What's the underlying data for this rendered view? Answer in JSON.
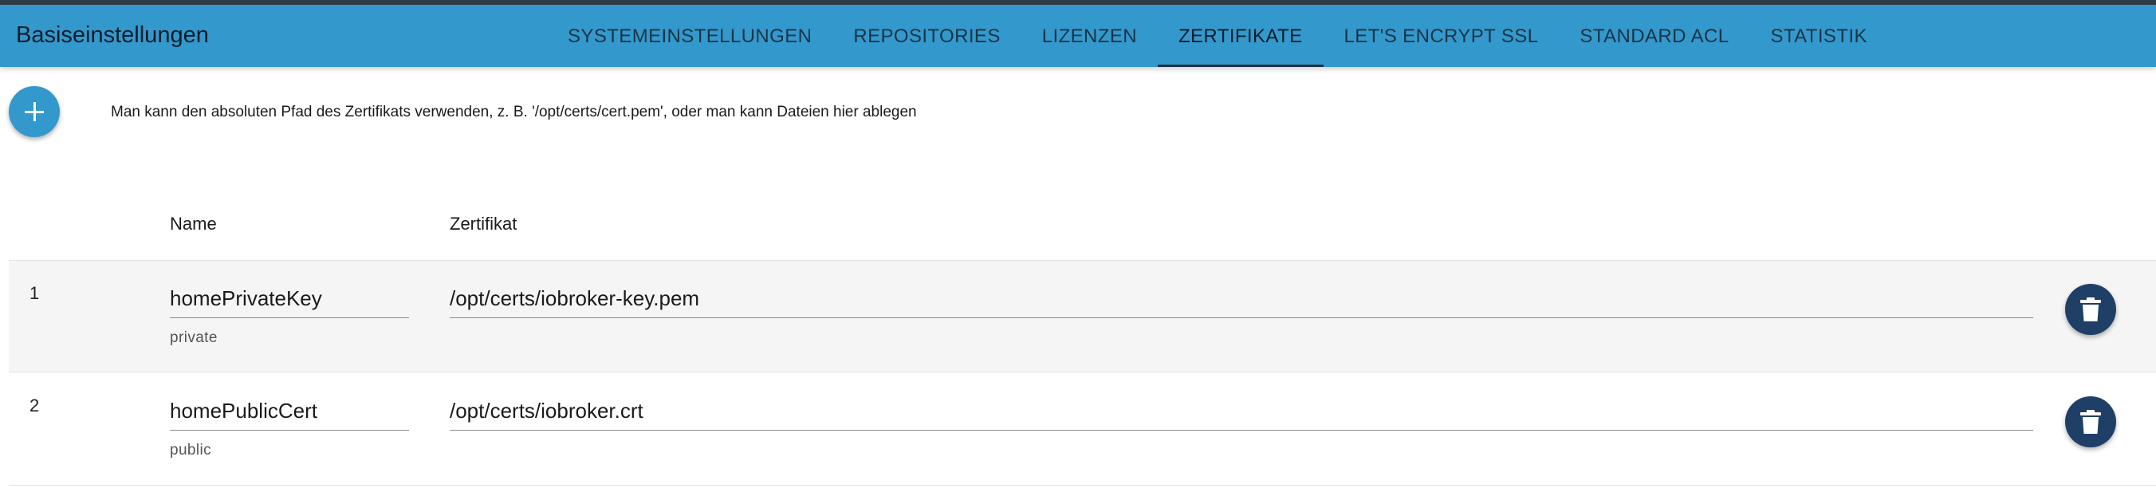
{
  "header": {
    "title": "Basiseinstellungen",
    "tabs": [
      {
        "label": "SYSTEMEINSTELLUNGEN"
      },
      {
        "label": "REPOSITORIES"
      },
      {
        "label": "LIZENZEN"
      },
      {
        "label": "ZERTIFIKATE",
        "active": true
      },
      {
        "label": "LET'S ENCRYPT SSL"
      },
      {
        "label": "STANDARD ACL"
      },
      {
        "label": "STATISTIK"
      }
    ]
  },
  "toolbar": {
    "add_icon": "plus-icon",
    "hint": "Man kann den absoluten Pfad des Zertifikats verwenden, z. B. '/opt/certs/cert.pem', oder man kann Dateien hier ablegen"
  },
  "table": {
    "columns": [
      "Name",
      "Zertifikat"
    ],
    "rows": [
      {
        "index": "1",
        "name": "homePrivateKey",
        "type": "private",
        "certificate": "/opt/certs/iobroker-key.pem"
      },
      {
        "index": "2",
        "name": "homePublicCert",
        "type": "public",
        "certificate": "/opt/certs/iobroker.crt"
      }
    ],
    "delete_icon": "trash-icon"
  },
  "colors": {
    "header_bg": "#3399cc",
    "fab_bg": "#3399cc",
    "delete_bg": "#1f3f66",
    "row_shade": "#f5f5f5"
  }
}
